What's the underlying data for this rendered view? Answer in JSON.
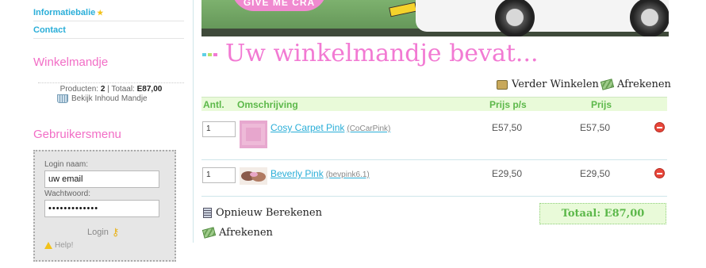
{
  "sidebar": {
    "nav": [
      {
        "label": "Informatiebalie"
      },
      {
        "label": "Contact"
      }
    ],
    "cart": {
      "title": "Winkelmandje",
      "products_label": "Producten:",
      "products_count": "2",
      "total_label": "Totaal:",
      "total_value": "E87,00",
      "view_link": "Bekijk Inhoud Mandje"
    },
    "user_menu": {
      "title": "Gebruikersmenu",
      "username_label": "Login naam:",
      "username_value": "uw email",
      "password_label": "Wachtwoord:",
      "password_value": "•••••••••••••",
      "login_button": "Login",
      "help_link": "Help!"
    }
  },
  "banner": {
    "sign_text": "GIVE ME CRA"
  },
  "main": {
    "title": "Uw winkelmandje bevat...",
    "continue_shopping": "Verder Winkelen",
    "checkout": "Afrekenen",
    "table": {
      "headers": [
        "Antl.",
        "Omschrijving",
        "Prijs p/s",
        "Prijs"
      ],
      "rows": [
        {
          "qty": "1",
          "name": "Cosy Carpet Pink",
          "code": "(CoCarPink)",
          "unit_price": "E57,50",
          "price": "E57,50"
        },
        {
          "qty": "1",
          "name": "Beverly Pink",
          "code": "(bevpink6.1)",
          "unit_price": "E29,50",
          "price": "E29,50"
        }
      ]
    },
    "recalculate": "Opnieuw Berekenen",
    "checkout_bottom": "Afrekenen",
    "total": "Totaal: E87,00"
  },
  "colors": {
    "pink": "#f27ad3",
    "link": "#2aaed8",
    "green": "#5cb84a"
  }
}
